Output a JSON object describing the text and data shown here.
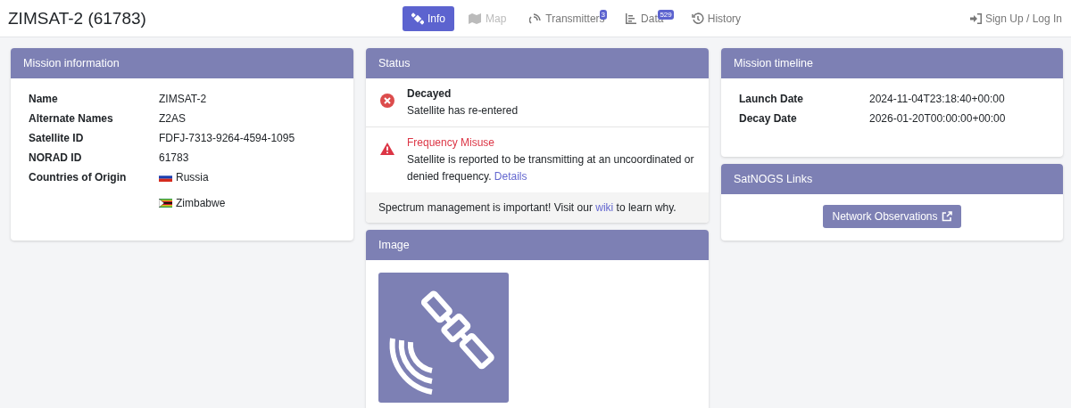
{
  "header": {
    "title": "ZIMSAT-2 (61783)",
    "auth_link": "Sign Up / Log In"
  },
  "tabs": [
    {
      "label": "Info",
      "kind": "info",
      "selected": true,
      "disabled": false
    },
    {
      "label": "Map",
      "kind": "map",
      "selected": false,
      "disabled": true
    },
    {
      "label": "Transmitters",
      "kind": "transmitters",
      "selected": false,
      "disabled": false,
      "badge": "3"
    },
    {
      "label": "Data",
      "kind": "data",
      "selected": false,
      "disabled": false,
      "badge": "529"
    },
    {
      "label": "History",
      "kind": "history",
      "selected": false,
      "disabled": false
    }
  ],
  "mission_information": {
    "title": "Mission information",
    "rows": [
      {
        "label": "Name",
        "values": [
          {
            "text": "ZIMSAT-2"
          }
        ]
      },
      {
        "label": "Alternate Names",
        "values": [
          {
            "text": "Z2AS"
          }
        ]
      },
      {
        "label": "Satellite ID",
        "values": [
          {
            "text": "FDFJ-7313-9264-4594-1095"
          }
        ]
      },
      {
        "label": "NORAD ID",
        "values": [
          {
            "text": "61783"
          }
        ]
      },
      {
        "label": "Countries of Origin",
        "values": [
          {
            "text": "Russia",
            "kind": "ru"
          },
          {
            "text": "Zimbabwe",
            "kind": "zw"
          }
        ]
      }
    ]
  },
  "status": {
    "title": "Status",
    "items": [
      {
        "kind": "error",
        "title": "Decayed",
        "text": "Satellite has re-entered"
      },
      {
        "kind": "warning",
        "title": "Frequency Misuse",
        "text": "Satellite is reported to be transmitting at an uncoordinated or denied frequency.",
        "link": "Details"
      }
    ],
    "footer": {
      "before": "Spectrum management is important! Visit our ",
      "link": "wiki",
      "after": " to learn why."
    }
  },
  "image": {
    "title": "Image"
  },
  "mission_timeline": {
    "title": "Mission timeline",
    "rows": [
      {
        "label": "Launch Date",
        "value": "2024-11-04T23:18:40+00:00"
      },
      {
        "label": "Decay Date",
        "value": "2026-01-20T00:00:00+00:00"
      }
    ]
  },
  "satnogs_links": {
    "title": "SatNOGS Links",
    "buttons": [
      "Network Observations"
    ]
  }
}
